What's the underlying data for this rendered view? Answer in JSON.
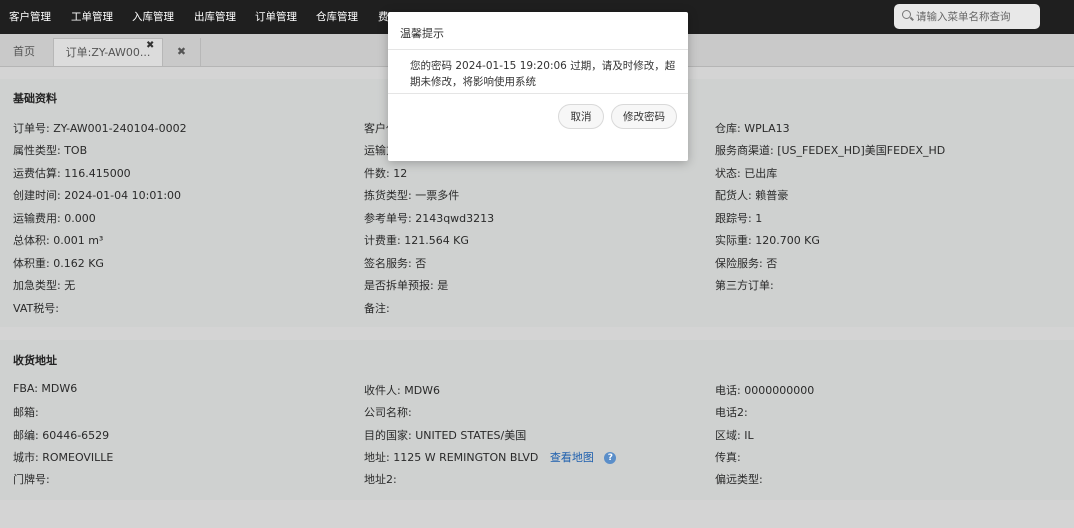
{
  "nav": {
    "items": [
      "客户管理",
      "工单管理",
      "入库管理",
      "出库管理",
      "订单管理",
      "仓库管理",
      "费"
    ],
    "search_placeholder": "请输入菜单名称查询"
  },
  "tabs": {
    "home": "首页",
    "order": "订单:ZY-AW00...",
    "close_all": "✖"
  },
  "basic": {
    "title": "基础资料",
    "rows": [
      [
        "订单号: ZY-AW001-240104-0002",
        "客户代",
        "仓库: WPLA13"
      ],
      [
        "属性类型: TOB",
        "运输方",
        "服务商渠道: [US_FEDEX_HD]美国FEDEX_HD"
      ],
      [
        "运费估算: 116.415000",
        "件数: 12",
        "状态: 已出库"
      ],
      [
        "创建时间: 2024-01-04 10:01:00",
        "拣货类型: 一票多件",
        "配货人: 赖普豪"
      ],
      [
        "运输费用: 0.000",
        "参考单号: 2143qwd3213",
        "跟踪号: 1"
      ],
      [
        "总体积: 0.001 m³",
        "计费重: 121.564 KG",
        "实际重: 120.700 KG"
      ],
      [
        "体积重: 0.162 KG",
        "签名服务: 否",
        "保险服务: 否"
      ],
      [
        "加急类型: 无",
        "是否拆单预报: 是",
        "第三方订单:"
      ],
      [
        "VAT税号:",
        "备注:",
        ""
      ]
    ]
  },
  "address": {
    "title": "收货地址",
    "rows": [
      [
        "FBA: MDW6",
        "收件人: MDW6",
        "电话: 0000000000"
      ],
      [
        "邮箱:",
        "公司名称:",
        "电话2:"
      ],
      [
        "邮编: 60446-6529",
        "目的国家: UNITED STATES/美国",
        "区域: IL"
      ],
      [
        "城市: ROMEOVILLE",
        "地址:  1125 W REMINGTON BLVD",
        "传真:"
      ],
      [
        "门牌号:",
        "地址2:",
        "偏远类型:"
      ]
    ],
    "map_link": "查看地图",
    "help_glyph": "?"
  },
  "modal": {
    "title": "温馨提示",
    "message": "您的密码 2024-01-15 19:20:06 过期，请及时修改，超期未修改，将影响使用系统",
    "cancel": "取消",
    "change_password": "修改密码"
  },
  "colors": {
    "nav_bg": "#1f1f1f",
    "link": "#1d5fae",
    "overlay": "#cfd1d0"
  }
}
